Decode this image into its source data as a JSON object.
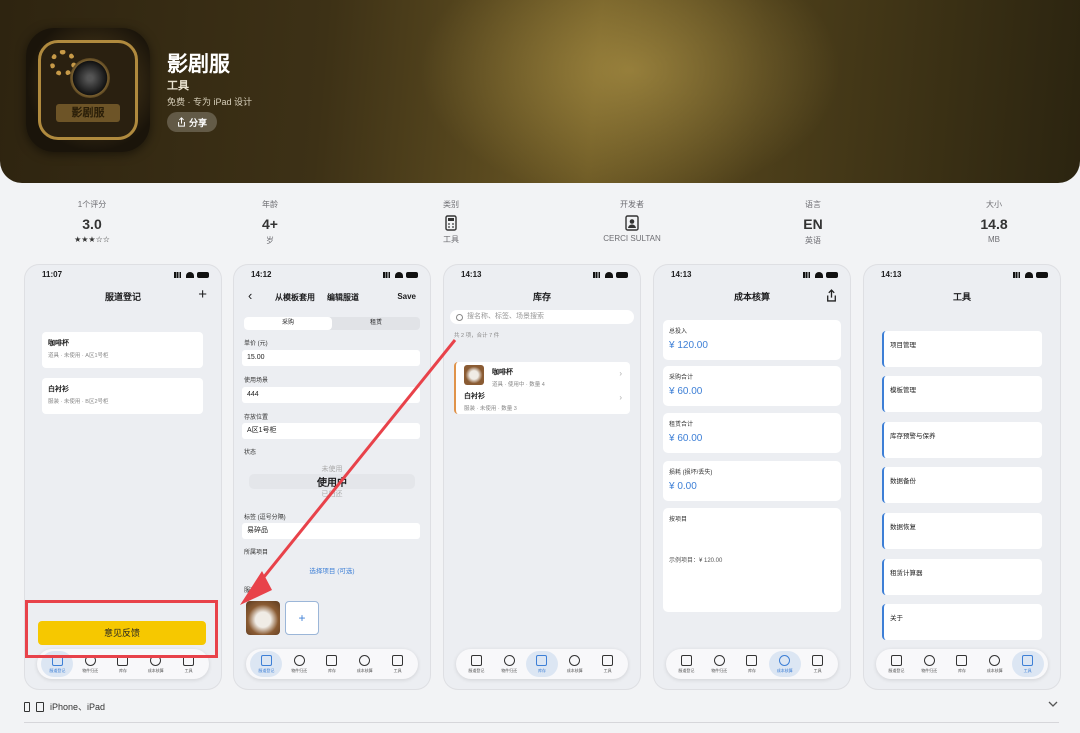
{
  "app": {
    "title": "影剧服",
    "category": "工具",
    "subtitle": "免费 · 专为 iPad 设计",
    "share_label": "分享",
    "icon_text": "影剧服"
  },
  "stats": [
    {
      "label": "1个评分",
      "value": "3.0",
      "sub": "★★★☆☆"
    },
    {
      "label": "年龄",
      "value": "4+",
      "sub": "岁"
    },
    {
      "label": "类别",
      "icon": "calculator-icon",
      "sub": "工具"
    },
    {
      "label": "开发者",
      "icon": "person-icon",
      "sub": "CERCI SULTAN"
    },
    {
      "label": "语言",
      "value": "EN",
      "sub": "英语"
    },
    {
      "label": "大小",
      "value": "14.8",
      "sub": "MB"
    }
  ],
  "tabs": [
    "服道登记",
    "物件归还",
    "库存",
    "成本核算",
    "工具"
  ],
  "screen1": {
    "time": "11:07",
    "title": "服道登记",
    "add": "+",
    "items": [
      {
        "name": "咖啡杯",
        "meta": "道具 · 未使用 · A区1号柜"
      },
      {
        "name": "白衬衫",
        "meta": "服装 · 未使用 · B区2号柜"
      }
    ],
    "feedback": "意见反馈"
  },
  "screen2": {
    "time": "14:12",
    "back_label": "从模板套用",
    "title": "编辑服道",
    "save": "Save",
    "segments": [
      "采购",
      "租赁"
    ],
    "fields": [
      {
        "label": "单价 (元)",
        "value": "15.00"
      },
      {
        "label": "使用场景",
        "value": "444"
      },
      {
        "label": "存放位置",
        "value": "A区1号柜"
      }
    ],
    "status_label": "状态",
    "status_options": [
      "未使用",
      "使用中",
      "已归还"
    ],
    "tags_label": "标签 (逗号分隔)",
    "tags_value": "易碎品",
    "project_label": "所属项目",
    "project_link": "选择项目 (可选)",
    "photo_label": "服道照片",
    "add_photo": "+"
  },
  "screen3": {
    "time": "14:13",
    "title": "库存",
    "search_placeholder": "搜名称、标签、场景搜索",
    "summary": "共 2 项，合计 7 件",
    "items": [
      {
        "name": "咖啡杯",
        "meta": "道具 · 使用中 · 数量 4"
      },
      {
        "name": "白衬衫",
        "meta": "服装 · 未使用 · 数量 3"
      }
    ]
  },
  "screen4": {
    "time": "14:13",
    "title": "成本核算",
    "rows": [
      {
        "label": "总投入",
        "value": "¥ 120.00"
      },
      {
        "label": "采购合计",
        "value": "¥ 60.00"
      },
      {
        "label": "租赁合计",
        "value": "¥ 60.00"
      },
      {
        "label": "损耗 (损坏/丢失)",
        "value": "¥ 0.00"
      }
    ],
    "project_label": "按项目",
    "project_line": "示例项目：¥ 120.00"
  },
  "screen5": {
    "time": "14:13",
    "title": "工具",
    "items": [
      "项目管理",
      "模板管理",
      "库存预警与保养",
      "数据备份",
      "数据恢复",
      "租赁计算器",
      "关于"
    ]
  },
  "footer": {
    "devices": "iPhone、iPad"
  },
  "colors": {
    "accent": "#3d7fd6",
    "feedback_button": "#f6c800",
    "annotation": "#e8424a"
  }
}
